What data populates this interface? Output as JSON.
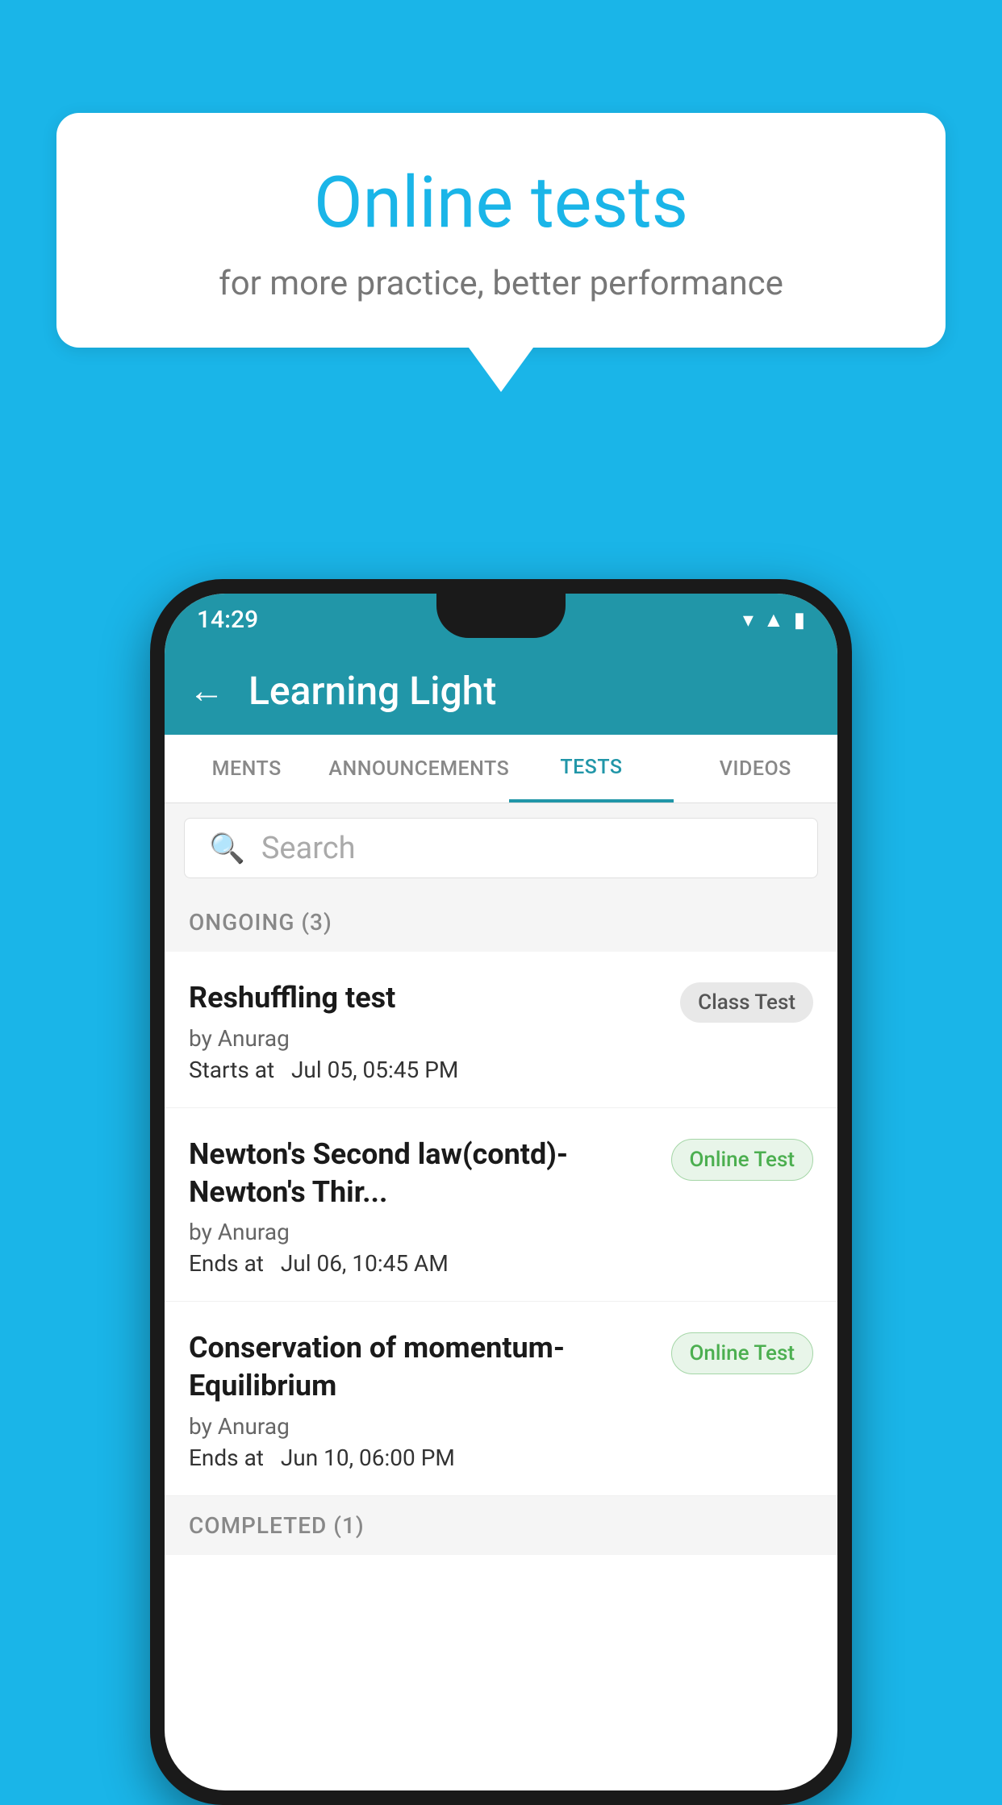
{
  "background_color": "#1ab5e8",
  "speech_bubble": {
    "title": "Online tests",
    "subtitle": "for more practice, better performance"
  },
  "phone": {
    "status_bar": {
      "time": "14:29",
      "icons": [
        "wifi",
        "signal",
        "battery"
      ]
    },
    "app_bar": {
      "title": "Learning Light",
      "back_label": "←"
    },
    "tabs": [
      {
        "label": "MENTS",
        "active": false
      },
      {
        "label": "ANNOUNCEMENTS",
        "active": false
      },
      {
        "label": "TESTS",
        "active": true
      },
      {
        "label": "VIDEOS",
        "active": false
      }
    ],
    "search": {
      "placeholder": "Search"
    },
    "sections": [
      {
        "label": "ONGOING (3)",
        "items": [
          {
            "title": "Reshuffling test",
            "author": "by Anurag",
            "time_label": "Starts at",
            "time_value": "Jul 05, 05:45 PM",
            "badge": "Class Test",
            "badge_type": "class"
          },
          {
            "title": "Newton's Second law(contd)-Newton's Thir...",
            "author": "by Anurag",
            "time_label": "Ends at",
            "time_value": "Jul 06, 10:45 AM",
            "badge": "Online Test",
            "badge_type": "online"
          },
          {
            "title": "Conservation of momentum-Equilibrium",
            "author": "by Anurag",
            "time_label": "Ends at",
            "time_value": "Jun 10, 06:00 PM",
            "badge": "Online Test",
            "badge_type": "online"
          }
        ]
      },
      {
        "label": "COMPLETED (1)",
        "items": []
      }
    ]
  }
}
